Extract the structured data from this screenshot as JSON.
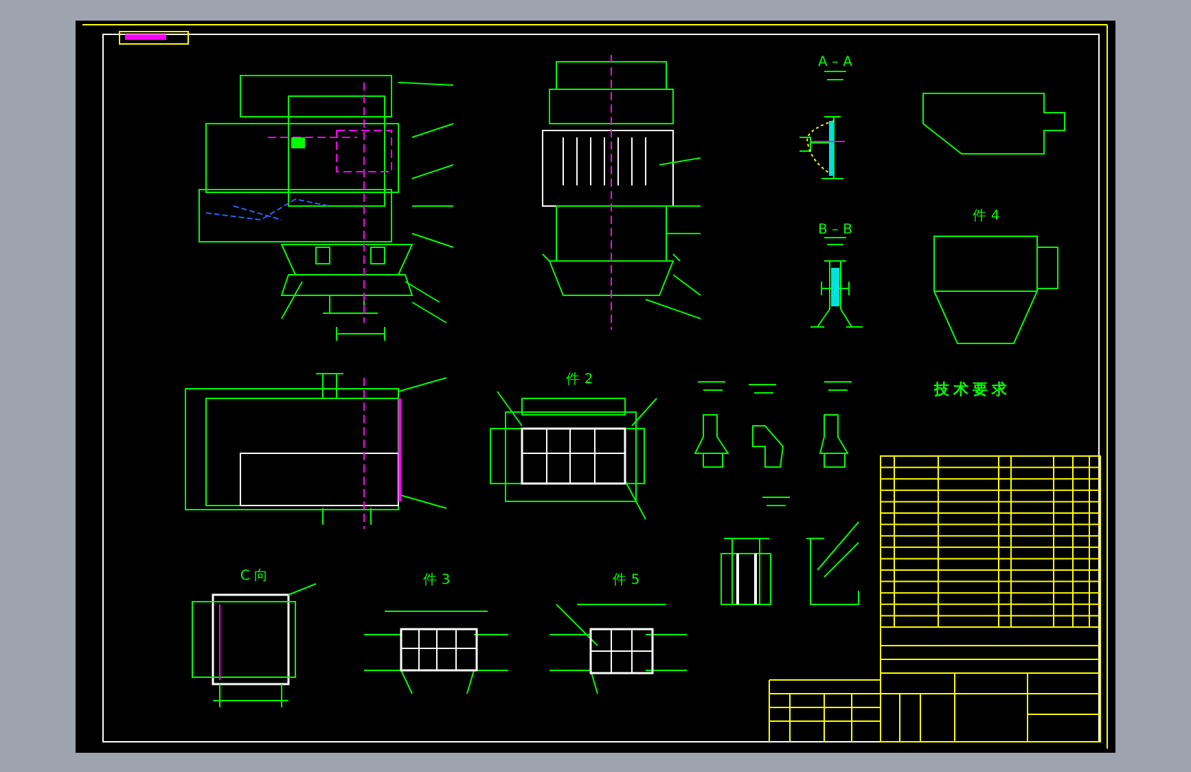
{
  "sheet": {
    "view_labels": [
      {
        "text": "A – A",
        "kind": "title"
      },
      {
        "text": "B – B",
        "kind": "title"
      },
      {
        "text": "件 4",
        "kind": "title"
      },
      {
        "text": "件 2",
        "kind": "title"
      },
      {
        "text": "技术要求",
        "kind": "heading"
      },
      {
        "text": "C 向",
        "kind": "title"
      },
      {
        "text": "件 3",
        "kind": "title"
      },
      {
        "text": "件 5",
        "kind": "title"
      }
    ]
  }
}
